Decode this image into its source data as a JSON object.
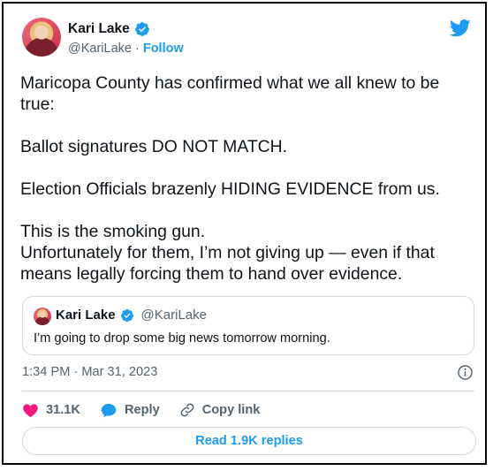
{
  "tweet": {
    "author_name": "Kari Lake",
    "author_handle": "@KariLake",
    "separator": " · ",
    "follow_label": "Follow",
    "text": "Maricopa County has confirmed what we all knew to be\ntrue:\n\nBallot signatures DO NOT MATCH.\n\nElection Officials brazenly HIDING EVIDENCE from us.\n\nThis is the smoking gun.\nUnfortunately for them, I’m not giving up — even if that\nmeans legally forcing them to hand over evidence.",
    "timestamp": "1:34 PM · Mar 31, 2023"
  },
  "quoted": {
    "author_name": "Kari Lake",
    "author_handle": "@KariLake",
    "text": "I’m going to drop some big news tomorrow morning."
  },
  "actions": {
    "like_count": "31.1K",
    "reply_label": "Reply",
    "copy_link_label": "Copy link",
    "read_replies_label": "Read 1.9K replies"
  },
  "colors": {
    "accent": "#1d9bf0",
    "like": "#f91880",
    "text": "#0f1419",
    "secondary": "#536471",
    "border": "#cfd9de"
  },
  "icons": [
    "verified-badge-icon",
    "twitter-bird-icon",
    "info-icon",
    "heart-icon",
    "reply-bubble-icon",
    "link-icon"
  ]
}
